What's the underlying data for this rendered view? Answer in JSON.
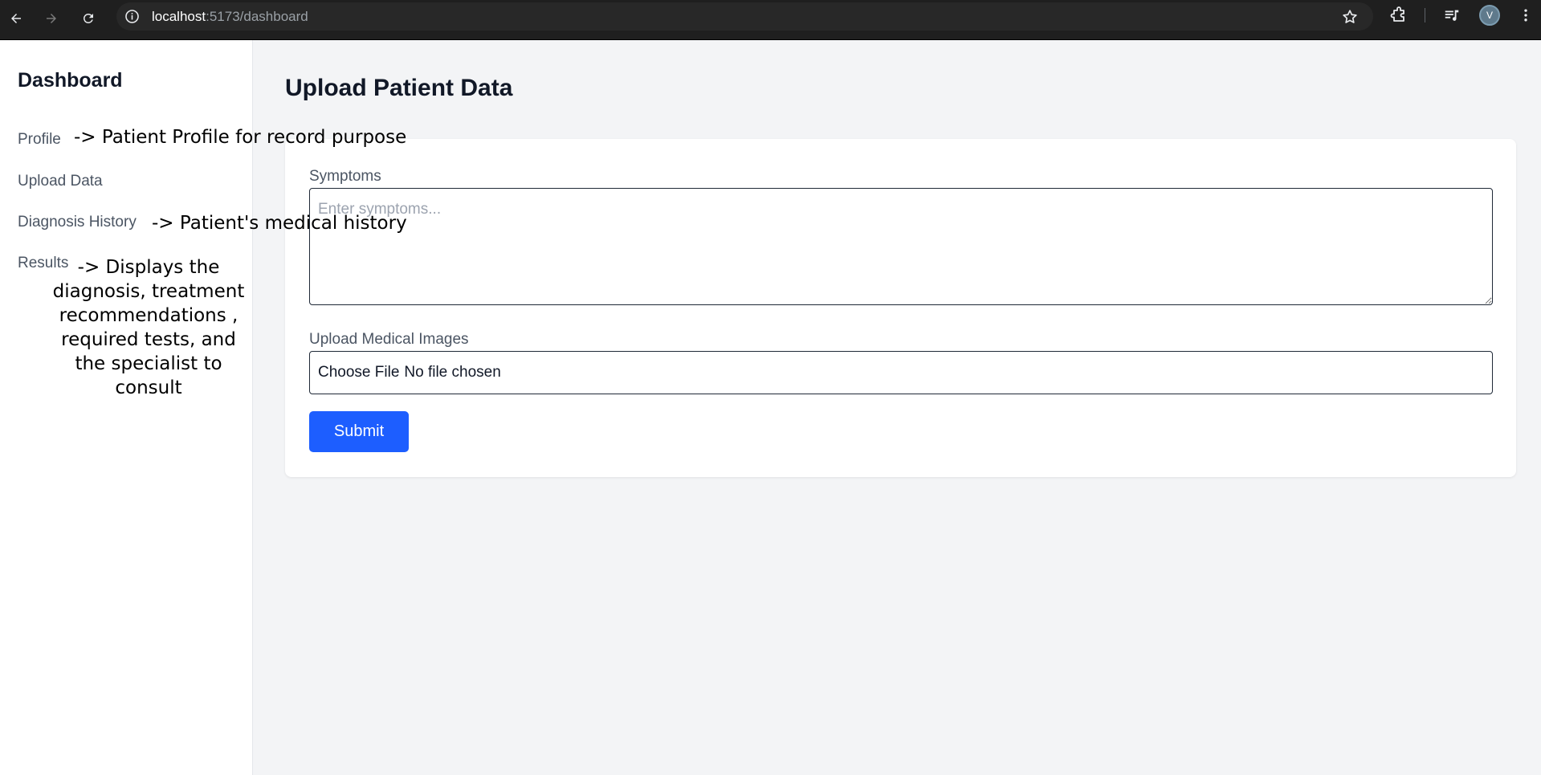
{
  "browser": {
    "url_host": "localhost",
    "url_path": ":5173/dashboard",
    "avatar_letter": "V",
    "icons": [
      "back-arrow-icon",
      "forward-arrow-icon",
      "reload-icon",
      "info-icon",
      "star-icon",
      "extensions-icon",
      "media-control-icon",
      "menu-dots-icon"
    ]
  },
  "sidebar": {
    "title": "Dashboard",
    "items": [
      {
        "label": "Profile"
      },
      {
        "label": "Upload Data"
      },
      {
        "label": "Diagnosis History"
      },
      {
        "label": "Results"
      }
    ]
  },
  "annotations": {
    "profile": "->  Patient Profile for record purpose",
    "history": "-> Patient's medical history",
    "results": "-> Displays the diagnosis, treatment recommendations , required tests, and the specialist to consult"
  },
  "main": {
    "title": "Upload Patient Data",
    "symptoms_label": "Symptoms",
    "symptoms_placeholder": "Enter symptoms...",
    "images_label": "Upload Medical Images",
    "file_button": "Choose File",
    "file_status": "No file chosen",
    "submit_label": "Submit"
  },
  "colors": {
    "accent": "#1d5eff",
    "page_bg": "#f3f4f6",
    "browser_bar": "#1f1f1f"
  }
}
